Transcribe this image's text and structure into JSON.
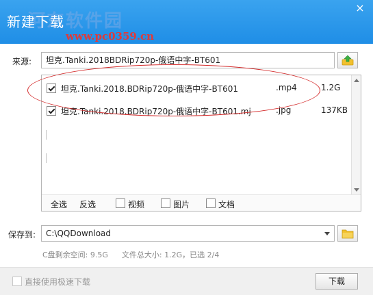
{
  "window": {
    "title": "新建下载",
    "watermark_text": "河东软件园",
    "watermark_url": "www.pc0359.cn",
    "close_glyph": "×"
  },
  "source": {
    "label": "来源:",
    "value": "坦克.Tanki.2018BDRip720p-俄语中字-BT601"
  },
  "files": [
    {
      "name": "坦克.Tanki.2018.BDRip720p-俄语中字-BT601",
      "ext": ".mp4",
      "size": "1.2G",
      "checked": true
    },
    {
      "name": "坦克.Tanki.2018.BDRip720p-俄语中字-BT601.mj",
      "ext": ".jpg",
      "size": "137KB",
      "checked": true
    }
  ],
  "filter": {
    "select_all": "全选",
    "invert": "反选",
    "video": "视频",
    "image": "图片",
    "document": "文档"
  },
  "save": {
    "label": "保存到:",
    "path": "C:\\QQDownload"
  },
  "disk": {
    "free": "C盘剩余空间: 9.5G",
    "total": "文件总大小: 1.2G，已选 2/4"
  },
  "bottom": {
    "direct_download_label": "直接使用极速下载",
    "download_button": "下载"
  },
  "colors": {
    "titlebar": "#2a98ea",
    "annotation_ellipse": "#d42a2a",
    "folder_icon": "#f2c12e"
  }
}
